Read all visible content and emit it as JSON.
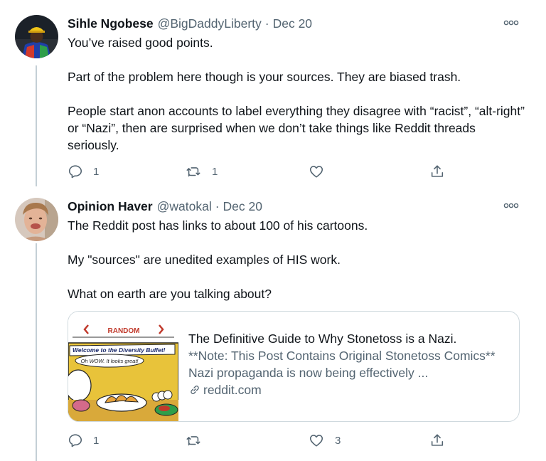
{
  "tweets": [
    {
      "author_name": "Sihle Ngobese",
      "handle": "@BigDaddyLiberty",
      "separator": "·",
      "date": "Dec 20",
      "paragraphs": [
        "You’ve raised good points.",
        "Part of the problem here though is your sources. They are biased trash.",
        "People start anon accounts to label everything they disagree with “racist”, “alt-right” or “Nazi”, then are surprised when we don’t take things like Reddit threads seriously."
      ],
      "reply_count": "1",
      "retweet_count": "1",
      "like_count": "",
      "more_icon": "more-horizontal-icon"
    },
    {
      "author_name": "Opinion Haver",
      "handle": "@watokal",
      "separator": "·",
      "date": "Dec 20",
      "paragraphs": [
        "The Reddit post has links to about 100 of his cartoons.",
        "My \"sources\" are unedited examples of HIS work.",
        "What on earth are you talking about?"
      ],
      "card": {
        "title": "The Definitive Guide to Why Stonetoss is a Nazi.",
        "description": "**Note: This Post Contains Original Stonetoss Comics** Nazi propaganda is now being effectively ...",
        "domain": "reddit.com",
        "thumbnail": {
          "nav_label": "RANDOM",
          "banner_text": "Welcome to the Diversity Buffet!",
          "bubble_text": "Oh WOW. It looks great!"
        }
      },
      "reply_count": "1",
      "retweet_count": "",
      "like_count": "3",
      "more_icon": "more-horizontal-icon"
    }
  ],
  "colors": {
    "text_primary": "#0f1419",
    "text_secondary": "#536471",
    "thread_line": "#c4cfd6",
    "card_border": "#cfd9de",
    "comic_red": "#c0392b",
    "comic_yellow": "#e8c33a"
  }
}
